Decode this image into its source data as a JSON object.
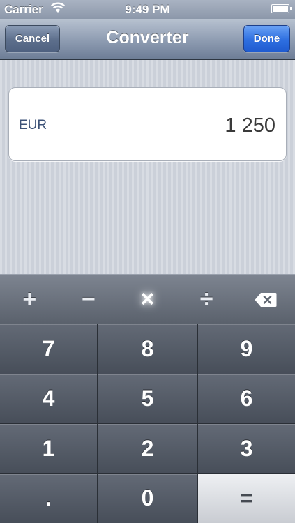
{
  "status_bar": {
    "carrier": "Carrier",
    "time": "9:49 PM",
    "wifi_icon": "wifi-icon",
    "battery_icon": "battery-icon"
  },
  "nav": {
    "title": "Converter",
    "cancel_label": "Cancel",
    "done_label": "Done"
  },
  "display": {
    "currency": "EUR",
    "amount": "1 250"
  },
  "keypad": {
    "operators": [
      {
        "label": "+",
        "name": "plus"
      },
      {
        "label": "−",
        "name": "minus"
      },
      {
        "label": "×",
        "name": "multiply",
        "active": true
      },
      {
        "label": "÷",
        "name": "divide"
      }
    ],
    "backspace_icon": "backspace-icon",
    "digits": [
      "7",
      "8",
      "9",
      "4",
      "5",
      "6",
      "1",
      "2",
      "3",
      ".",
      "0",
      "="
    ]
  },
  "colors": {
    "done_button": "#2e6fe0",
    "nav_bar": "#8d9bb1",
    "keypad": "#474e59"
  }
}
